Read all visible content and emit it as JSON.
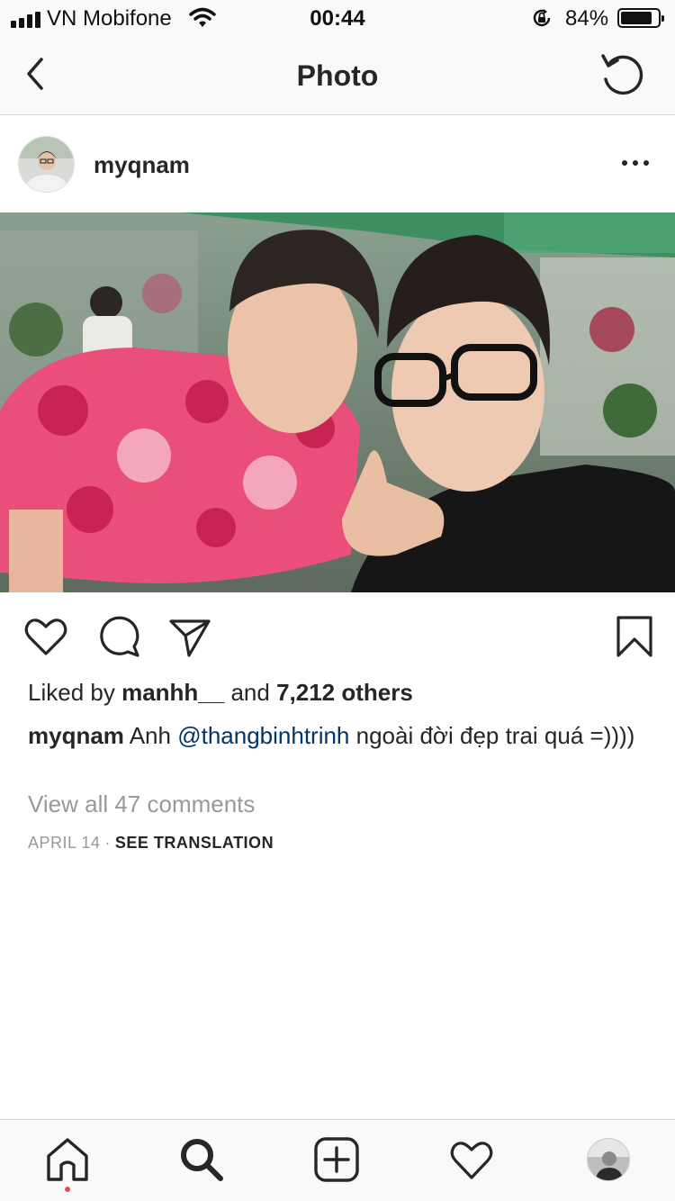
{
  "status_bar": {
    "carrier": "VN Mobifone",
    "time": "00:44",
    "battery_percent": "84%",
    "battery_level": 0.84,
    "icons": [
      "signal-icon",
      "wifi-icon",
      "orientation-lock-icon",
      "battery-icon"
    ]
  },
  "nav": {
    "title": "Photo",
    "back_icon": "chevron-left-icon",
    "refresh_icon": "refresh-icon"
  },
  "post": {
    "username": "myqnam",
    "more_icon": "more-horizontal-icon",
    "actions": [
      "heart-icon",
      "comment-icon",
      "share-icon",
      "bookmark-icon"
    ],
    "likes": {
      "prefix": "Liked by ",
      "liker": "manhh__",
      "middle": " and ",
      "others": "7,212 others"
    },
    "caption": {
      "username": "myqnam",
      "text_before": " Anh ",
      "mention": "@thangbinhtrinh",
      "text_after": " ngoài đời đẹp trai quá =))))"
    },
    "view_comments": "View all 47 comments",
    "date": "APRIL 14",
    "separator": "·",
    "see_translation": "SEE TRANSLATION"
  },
  "tabbar": {
    "items": [
      "home-icon",
      "search-icon",
      "add-post-icon",
      "activity-heart-icon",
      "profile-avatar"
    ]
  },
  "colors": {
    "mention": "#003569",
    "secondary_text": "#999999",
    "notification_dot": "#ed4956",
    "bar_background": "#f9f9f9"
  }
}
